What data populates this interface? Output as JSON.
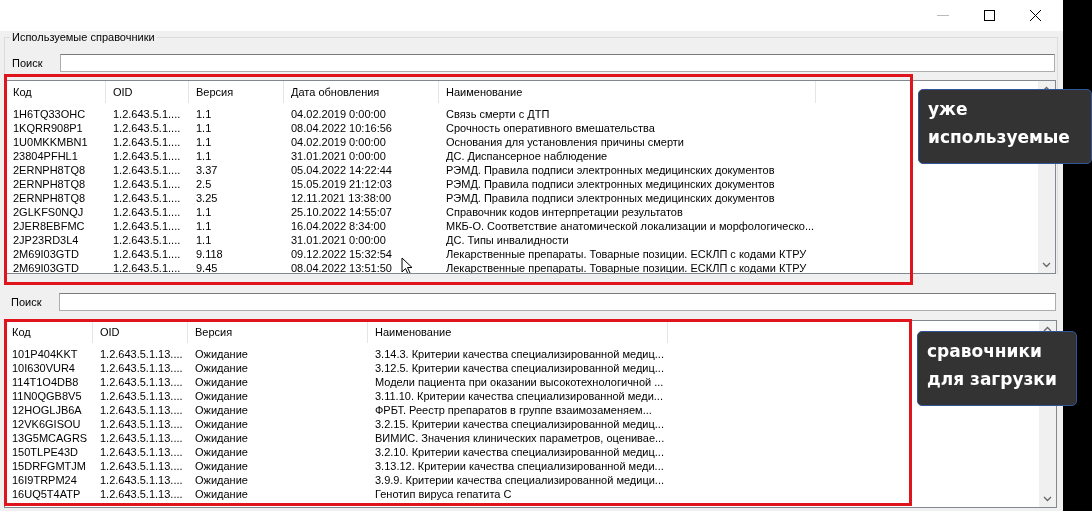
{
  "group_title": "Используемые справочники",
  "used": {
    "search": {
      "label": "Поиск"
    },
    "columns": [
      "Код",
      "OID",
      "Версия",
      "Дата обновления",
      "Наименование"
    ],
    "rows": [
      [
        "1H6TQ33OHC",
        "1.2.643.5.1....",
        "1.1",
        "04.02.2019 0:00:00",
        "Связь смерти с ДТП"
      ],
      [
        "1KQRR908P1",
        "1.2.643.5.1....",
        "1.1",
        "08.04.2022 10:16:56",
        "Срочность оперативного вмешательства"
      ],
      [
        "1U0MKKMBN1",
        "1.2.643.5.1....",
        "1.1",
        "04.02.2019 0:00:00",
        "Основания для установления причины смерти"
      ],
      [
        "23804PFHL1",
        "1.2.643.5.1....",
        "1.1",
        "31.01.2021 0:00:00",
        "ДС. Диспансерное наблюдение"
      ],
      [
        "2ERNPH8TQ8",
        "1.2.643.5.1....",
        "3.37",
        "05.04.2022 14:22:44",
        "РЭМД. Правила подписи электронных медицинских документов"
      ],
      [
        "2ERNPH8TQ8",
        "1.2.643.5.1....",
        "2.5",
        "15.05.2019 21:12:03",
        "РЭМД. Правила подписи электронных медицинских документов"
      ],
      [
        "2ERNPH8TQ8",
        "1.2.643.5.1....",
        "3.25",
        "12.11.2021 13:38:00",
        "РЭМД. Правила подписи электронных медицинских документов"
      ],
      [
        "2GLKFS0NQJ",
        "1.2.643.5.1....",
        "1.1",
        "25.10.2022 14:55:07",
        "Справочник кодов интерпретации результатов"
      ],
      [
        "2JER8EBFMC",
        "1.2.643.5.1....",
        "1.1",
        "16.04.2022 8:34:00",
        "МКБ-О. Соответствие анатомической локализации и морфологическо..."
      ],
      [
        "2JP23RD3L4",
        "1.2.643.5.1....",
        "1.1",
        "31.01.2021 0:00:00",
        "ДС. Типы инвалидности"
      ],
      [
        "2M69I03GTD",
        "1.2.643.5.1....",
        "9.118",
        "09.12.2022 15:32:54",
        "Лекарственные препараты. Товарные позиции. ЕСКЛП с кодами КТРУ"
      ],
      [
        "2M69I03GTD",
        "1.2.643.5.1....",
        "9.45",
        "08.04.2022 13:51:50",
        "Лекарственные препараты. Товарные позиции. ЕСКЛП с кодами КТРУ"
      ]
    ]
  },
  "load": {
    "search": {
      "label": "Поиск"
    },
    "columns": [
      "Код",
      "OID",
      "Версия",
      "Наименование"
    ],
    "rows": [
      [
        "101P404KKT",
        "1.2.643.5.1.13....",
        "Ожидание",
        "3.14.3. Критерии качества специализированной медиц..."
      ],
      [
        "10I630VUR4",
        "1.2.643.5.1.13....",
        "Ожидание",
        "3.12.5. Критерии качества специализированной медиц..."
      ],
      [
        "114T1O4DB8",
        "1.2.643.5.1.13....",
        "Ожидание",
        "Модели пациента при оказании высокотехнологичной ..."
      ],
      [
        "11N0QGB8V5",
        "1.2.643.5.1.13....",
        "Ожидание",
        "3.11.10. Критерии качества специализированной меди..."
      ],
      [
        "12HOGLJB6A",
        "1.2.643.5.1.13....",
        "Ожидание",
        "ФРБТ. Реестр препаратов в группе взаимозаменяем..."
      ],
      [
        "12VK6GISOU",
        "1.2.643.5.1.13....",
        "Ожидание",
        "3.2.15. Критерии качества специализированной медиц..."
      ],
      [
        "13G5MCAGRS",
        "1.2.643.5.1.13....",
        "Ожидание",
        "ВИМИС. Значения клинических параметров, оценивае..."
      ],
      [
        "150TLPE43D",
        "1.2.643.5.1.13....",
        "Ожидание",
        "3.2.10. Критерии качества специализированной медиц..."
      ],
      [
        "15DRFGMTJM",
        "1.2.643.5.1.13....",
        "Ожидание",
        "3.13.12. Критерии качества специализированной меди..."
      ],
      [
        "16I9TRPM24",
        "1.2.643.5.1.13....",
        "Ожидание",
        "3.9.9. Критерии качества специализированной медици..."
      ],
      [
        "16UQ5T4ATP",
        "1.2.643.5.1.13....",
        "Ожидание",
        "Генотип вируса гепатита С"
      ]
    ]
  },
  "annotations": [
    "уже используемые",
    "сравочники для загрузки"
  ]
}
